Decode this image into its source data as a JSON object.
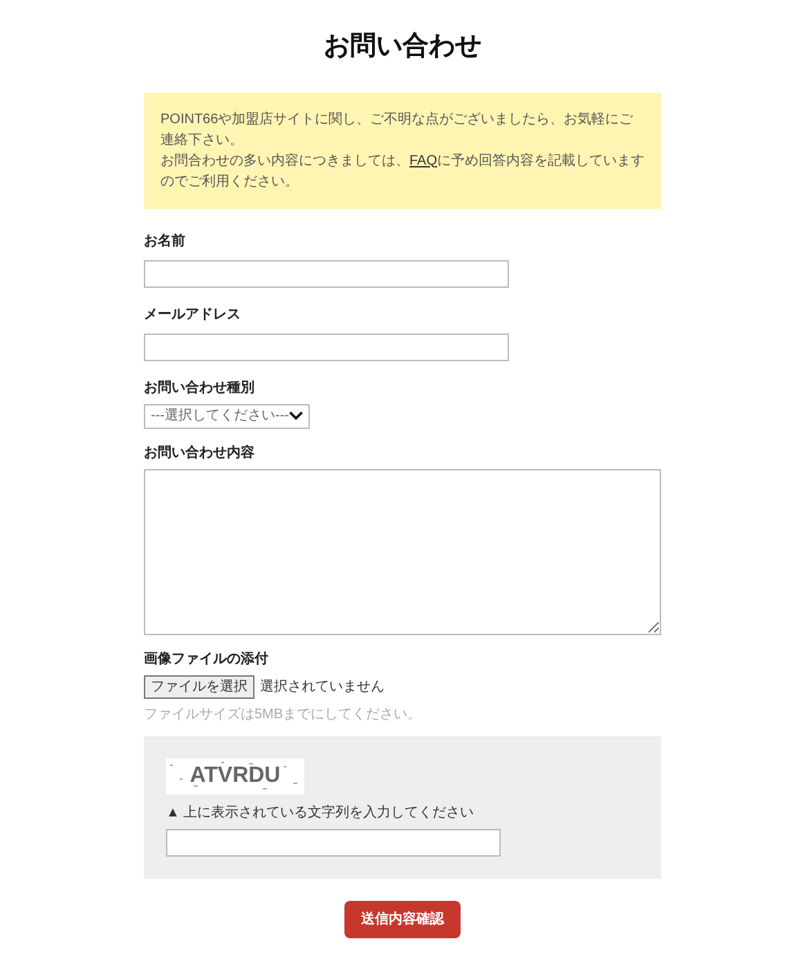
{
  "title": "お問い合わせ",
  "notice": {
    "lines": [
      "POINT66や加盟店サイトに関し、ご不明な点がございましたら、お気軽にご連絡下さい。"
    ],
    "line2_before": "お問合わせの多い内容につきましては、",
    "link": "FAQ",
    "line2_after": "に予め回答内容を記載していますのでご利用ください。"
  },
  "fields": [
    {
      "kind": "text",
      "label": "お名前"
    },
    {
      "kind": "text",
      "label": "メールアドレス"
    },
    {
      "kind": "select",
      "label": "お問い合わせ種別",
      "value": "---選択してください---"
    },
    {
      "kind": "textarea",
      "label": "お問い合わせ内容"
    }
  ],
  "attachment": {
    "label": "画像ファイルの添付",
    "button": "ファイルを選択",
    "status": "選択されていません",
    "hint": "ファイルサイズは5MBまでにしてください。"
  },
  "captcha": {
    "code": "ATVRDU",
    "instruction": "▲ 上に表示されている文字列を入力してください"
  },
  "submit": "送信内容確認"
}
